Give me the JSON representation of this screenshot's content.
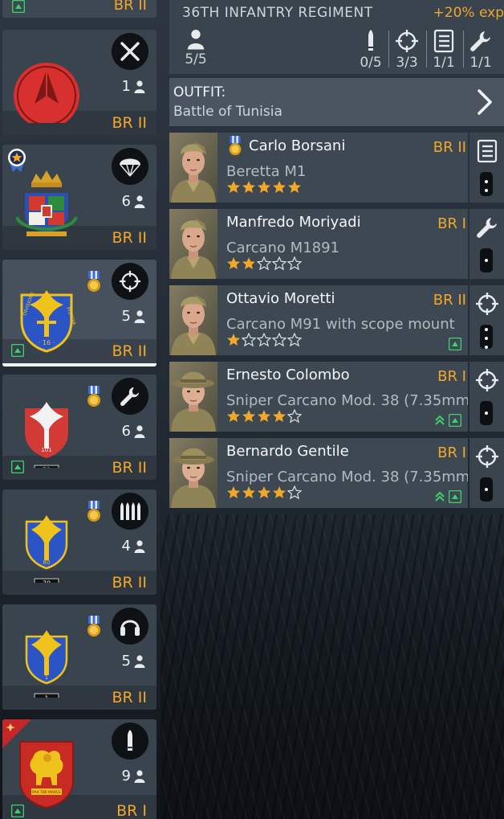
{
  "colors": {
    "accent": "#f0a72a",
    "panel": "#3d4853",
    "green": "#3fcf6c"
  },
  "top_strip": {
    "br": "BR II"
  },
  "squads": [
    {
      "count": "1",
      "br": "BR II",
      "role_icon": "crossed-tools-icon",
      "emblem": "red-circle-emblem"
    },
    {
      "count": "6",
      "br": "BR II",
      "role_icon": "parachute-icon",
      "emblem": "crowned-shield-emblem"
    },
    {
      "count": "5",
      "br": "BR II",
      "role_icon": "crosshair-icon",
      "emblem": "division-16-pistoia-emblem",
      "emblem_text": "DIVISIONE · 16 · PISTOIA"
    },
    {
      "count": "6",
      "br": "BR II",
      "role_icon": "wrench-icon",
      "emblem": "division-101-trieste-emblem",
      "plate": "52"
    },
    {
      "count": "4",
      "br": "BR II",
      "role_icon": "ammo-icon",
      "emblem": "division-80-la-spezia-emblem",
      "plate": "70"
    },
    {
      "count": "5",
      "br": "BR II",
      "role_icon": "headphones-icon",
      "emblem": "division-1-superga-emblem",
      "plate": "1"
    },
    {
      "count": "9",
      "br": "BR I",
      "role_icon": "bullet-icon",
      "emblem": "lion-of-st-mark-emblem",
      "motto": "PAX TIBI MARCE"
    }
  ],
  "header": {
    "title": "36TH INFANTRY REGIMENT",
    "bonus": "+20% exp",
    "stats": [
      {
        "icon": "soldier-icon",
        "value": "5/5"
      },
      {
        "icon": "bullet-icon",
        "value": "0/5"
      },
      {
        "icon": "crosshair-icon",
        "value": "3/3"
      },
      {
        "icon": "list-icon",
        "value": "1/1"
      },
      {
        "icon": "wrench-icon",
        "value": "1/1"
      }
    ]
  },
  "outfit": {
    "label": "OUTFIT:",
    "value": "Battle of Tunisia"
  },
  "soldiers": [
    {
      "name": "Carlo Borsani",
      "weapon": "Beretta M1",
      "br": "BR II",
      "stars": 5,
      "class_icon": "list-icon",
      "rank_pips": 2,
      "medal": true
    },
    {
      "name": "Manfredo Moriyadi",
      "weapon": "Carcano M1891",
      "br": "BR I",
      "stars": 2,
      "class_icon": "wrench-icon",
      "rank_pips": 1
    },
    {
      "name": "Ottavio Moretti",
      "weapon": "Carcano M91 with scope mount",
      "br": "BR II",
      "stars": 1,
      "class_icon": "crosshair-icon",
      "rank_pips": 3
    },
    {
      "name": "Ernesto Colombo",
      "weapon": "Sniper Carcano Mod. 38 (7.35mm",
      "br": "BR I",
      "stars": 4,
      "class_icon": "crosshair-icon",
      "rank_pips": 1
    },
    {
      "name": "Bernardo Gentile",
      "weapon": "Sniper Carcano Mod. 38 (7.35mm",
      "br": "BR I",
      "stars": 4,
      "class_icon": "crosshair-icon",
      "rank_pips": 1
    }
  ]
}
